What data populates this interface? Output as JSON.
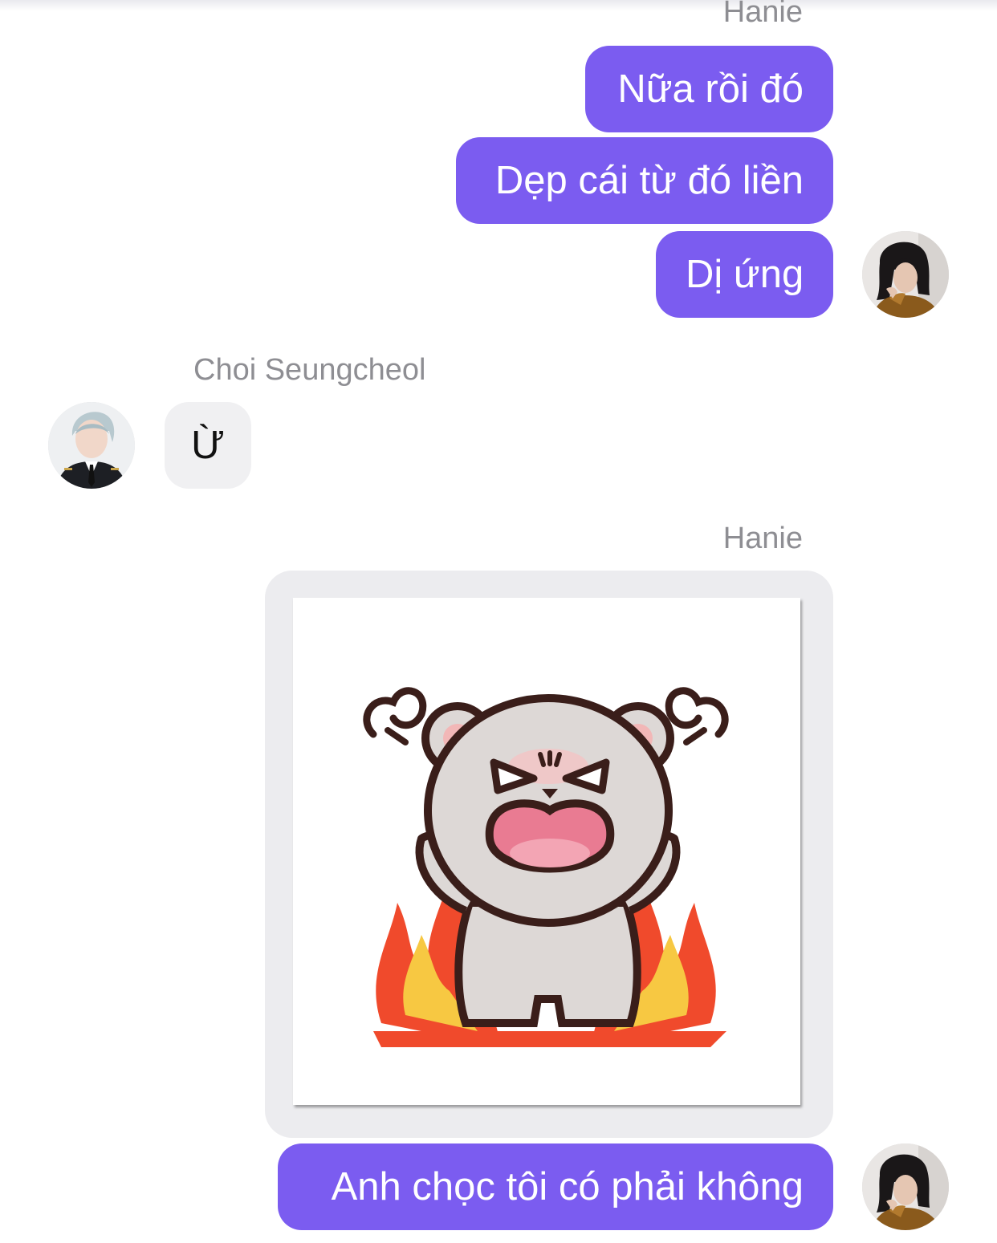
{
  "theme": {
    "accent": "#7b5cf0",
    "incoming_bubble": "#f0f0f2",
    "name_color": "#8e8e93"
  },
  "messages": {
    "group1": {
      "sender": "Hanie",
      "bubbles": [
        "Nữa rồi đó",
        "Dẹp cái từ đó liền",
        "Dị ứng"
      ],
      "avatar_icon": "user-photo-avatar"
    },
    "group2": {
      "sender": "Choi Seungcheol",
      "bubbles": [
        "Ừ"
      ],
      "avatar_icon": "user-photo-avatar"
    },
    "group3": {
      "sender": "Hanie",
      "sticker": "angry-bear-sticker",
      "bubbles": [
        "Anh chọc tôi có phải không"
      ],
      "avatar_icon": "user-photo-avatar"
    }
  }
}
